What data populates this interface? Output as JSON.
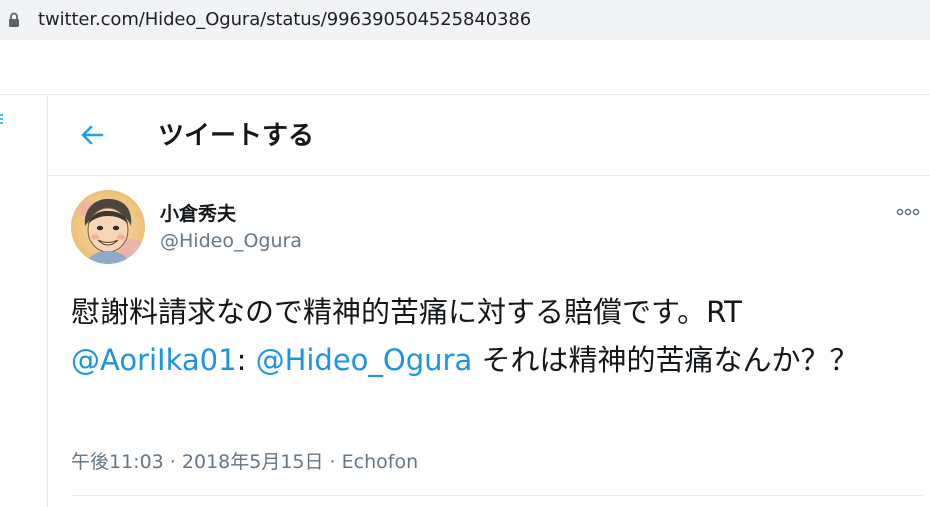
{
  "browser": {
    "url": "twitter.com/Hideo_Ogura/status/996390504525840386"
  },
  "header": {
    "title": "ツイートする"
  },
  "tweet": {
    "display_name": "小倉秀夫",
    "handle": "@Hideo_Ogura",
    "text_part1": "慰謝料請求なので精神的苦痛に対する賠償です。RT",
    "mention1": "@AoriIka01",
    "colon": ": ",
    "mention2": "@Hideo_Ogura",
    "text_part2": " それは精神的苦痛なんか？？",
    "time": "午後11:03",
    "date": "2018年5月15日",
    "source": "Echofon",
    "separator": " · "
  },
  "colors": {
    "accent": "#1da1f2",
    "mention": "#1b95e0",
    "secondary_text": "#657786",
    "border": "#e6ecf0"
  },
  "icons": {
    "lock": "lock-icon",
    "back": "back-arrow-icon",
    "more": "more-dots-icon"
  }
}
